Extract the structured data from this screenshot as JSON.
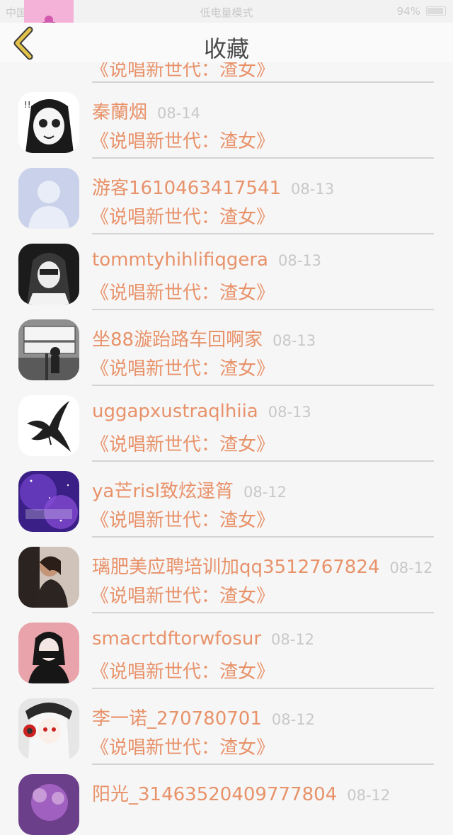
{
  "status_bar": {
    "carrier": "中国移动",
    "center": "低电量模式",
    "battery": "94%"
  },
  "header": {
    "title": "收藏"
  },
  "favorites": [
    {
      "user": "",
      "date": "",
      "title": "《说唱新世代：渣女》"
    },
    {
      "user": "秦蘭烟",
      "date": "08-14",
      "title": "《说唱新世代：渣女》"
    },
    {
      "user": "游客1610463417541",
      "date": "08-13",
      "title": "《说唱新世代：渣女》"
    },
    {
      "user": "tommtyhihlifiqgera",
      "date": "08-13",
      "title": "《说唱新世代：渣女》"
    },
    {
      "user": "坐88漩跆路车回啊家",
      "date": "08-13",
      "title": "《说唱新世代：渣女》"
    },
    {
      "user": "uggapxustraqlhiia",
      "date": "08-13",
      "title": "《说唱新世代：渣女》"
    },
    {
      "user": "ya芒risl致炫逯筲",
      "date": "08-12",
      "title": "《说唱新世代：渣女》"
    },
    {
      "user": "璃肥美应聘培训加qq3512767824",
      "date": "08-12",
      "title": "《说唱新世代：渣女》"
    },
    {
      "user": "smacrtdftorwfosur",
      "date": "08-12",
      "title": "《说唱新世代：渣女》"
    },
    {
      "user": "李一诺_270780701",
      "date": "08-12",
      "title": "《说唱新世代：渣女》"
    },
    {
      "user": "阳光_31463520409777804",
      "date": "08-12",
      "title": ""
    }
  ],
  "colors": {
    "accent": "#e8926a",
    "back_icon": "#e2c24a",
    "date": "#c8c8c8"
  }
}
